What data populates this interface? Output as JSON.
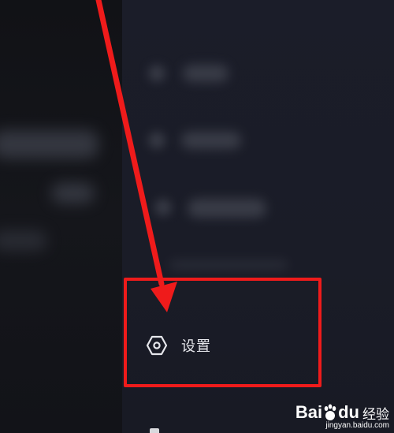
{
  "menu": {
    "settings_label": "设置",
    "settings_icon": "hexagon-settings-icon"
  },
  "annotation": {
    "color": "#ef1b1b"
  },
  "watermark": {
    "bai": "Bai",
    "du": "du",
    "jingyan": "经验",
    "url": "jingyan.baidu.com"
  }
}
